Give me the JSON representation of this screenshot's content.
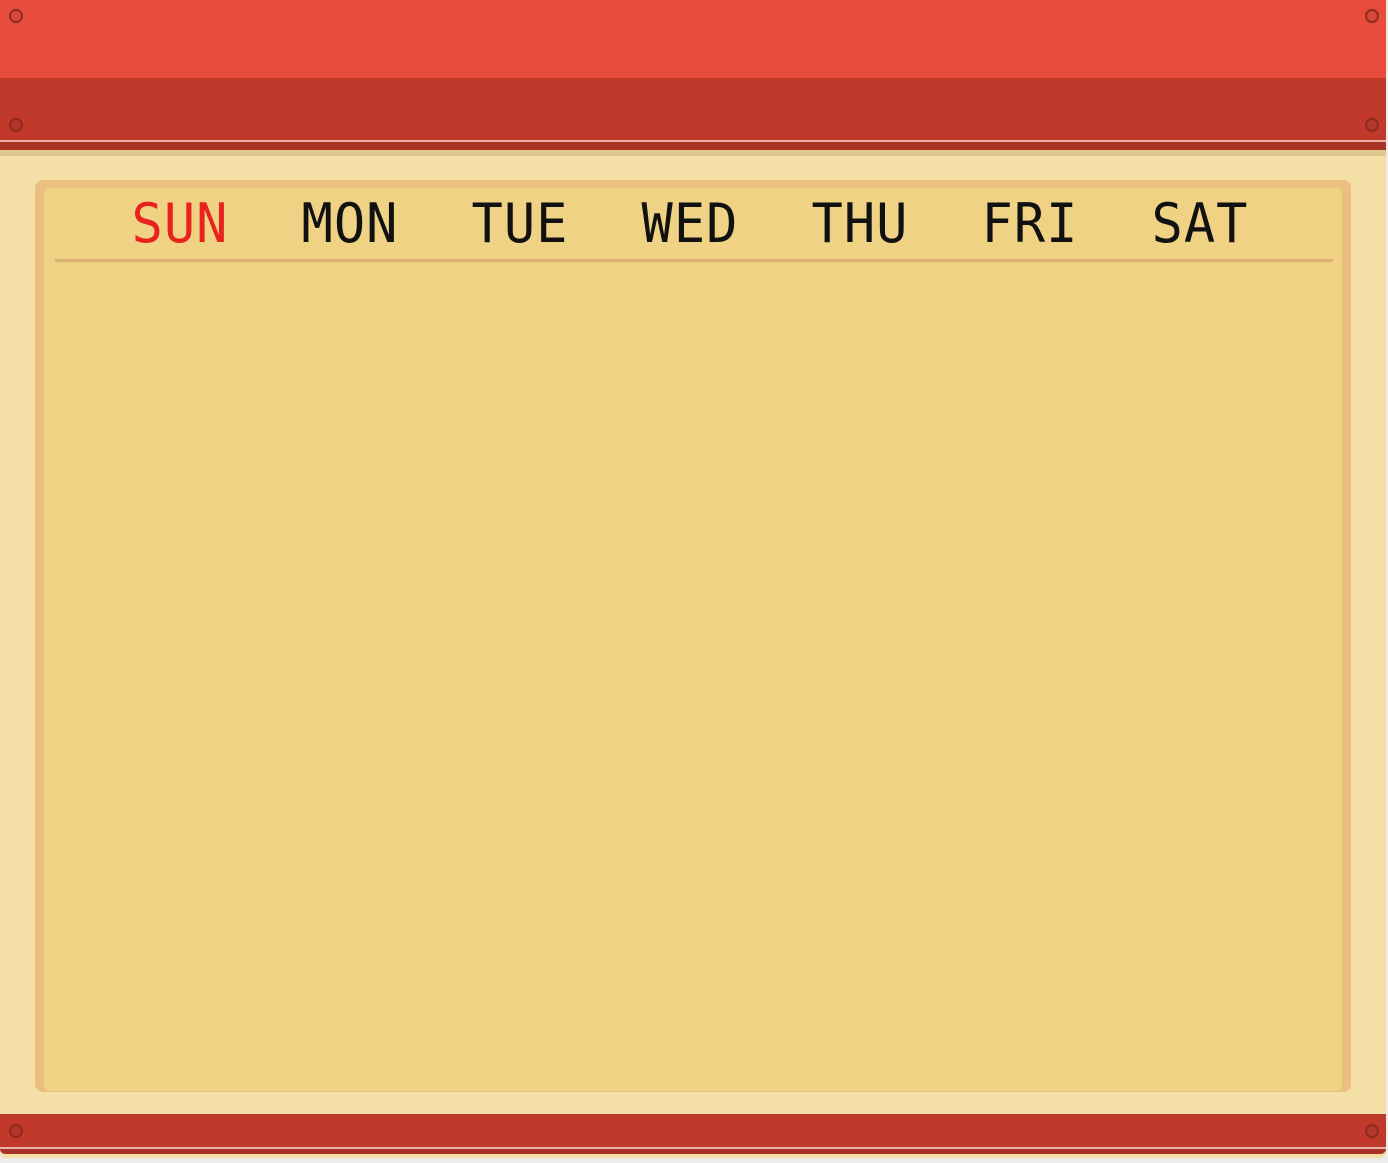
{
  "calendar": {
    "weekdays": [
      {
        "label": "SUN",
        "color": "#e8231f"
      },
      {
        "label": "MON",
        "color": "#111111"
      },
      {
        "label": "TUE",
        "color": "#111111"
      },
      {
        "label": "WED",
        "color": "#111111"
      },
      {
        "label": "THU",
        "color": "#111111"
      },
      {
        "label": "FRI",
        "color": "#111111"
      },
      {
        "label": "SAT",
        "color": "#111111"
      }
    ],
    "days": []
  },
  "theme": {
    "header_color": "#e74c3c",
    "header_band_color": "#c0392b",
    "frame_color": "#f4e0a7",
    "board_color": "#efd284",
    "board_border_color": "#ebbf80"
  }
}
